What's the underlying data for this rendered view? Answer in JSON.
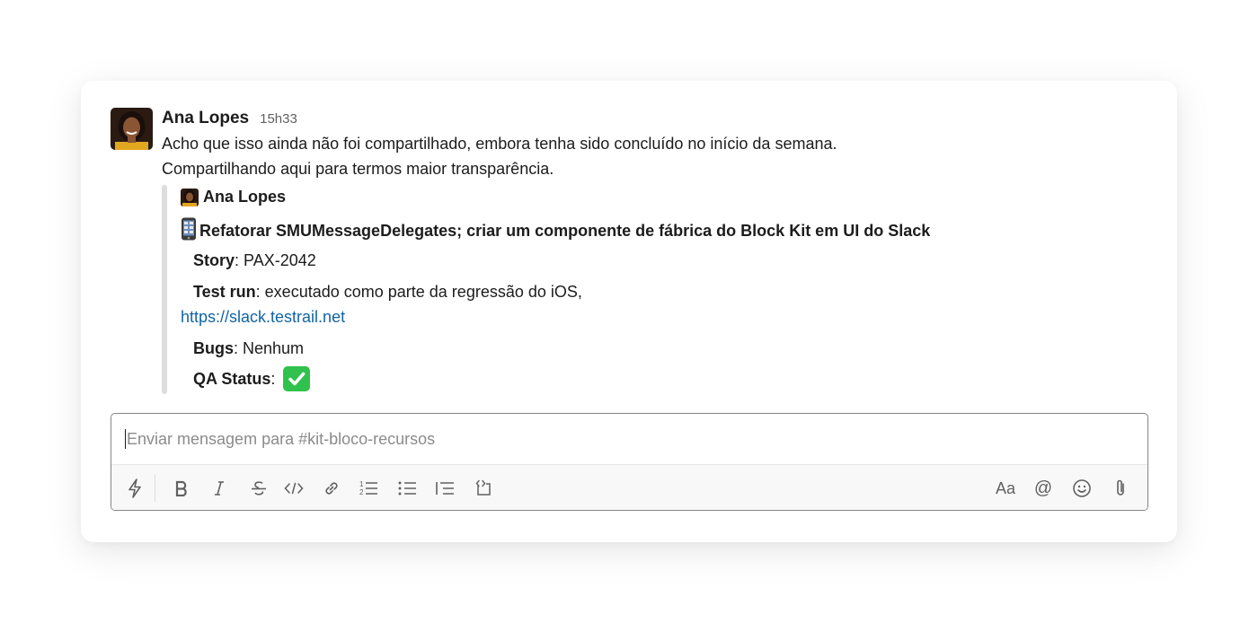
{
  "message": {
    "author": "Ana Lopes",
    "timestamp": "15h33",
    "lines": [
      "Acho que isso ainda não foi compartilhado, embora tenha sido concluído no início da semana.",
      "Compartilhando aqui para termos maior transparência."
    ]
  },
  "attachment": {
    "author": "Ana Lopes",
    "title": "Refatorar SMUMessageDelegates; criar um componente de fábrica do Block Kit em UI do Slack",
    "title_icon": "mobile-phone-icon",
    "fields": {
      "story": {
        "label": "Story",
        "value": ": PAX-2042"
      },
      "test_run": {
        "label": "Test run",
        "value": ": executado como parte da regressão do iOS,"
      },
      "link": "https://slack.testrail.net",
      "bugs": {
        "label": "Bugs",
        "value": ": Nenhum"
      },
      "qa_status": {
        "label": "QA Status",
        "value": ":",
        "icon": "check-mark-icon"
      }
    }
  },
  "composer": {
    "placeholder": "Enviar mensagem para #kit-bloco-recursos",
    "format_label": "Aa",
    "mention_label": "@"
  },
  "colors": {
    "link": "#1264a3",
    "check": "#30c24c",
    "quote_bar": "#dddddd"
  }
}
